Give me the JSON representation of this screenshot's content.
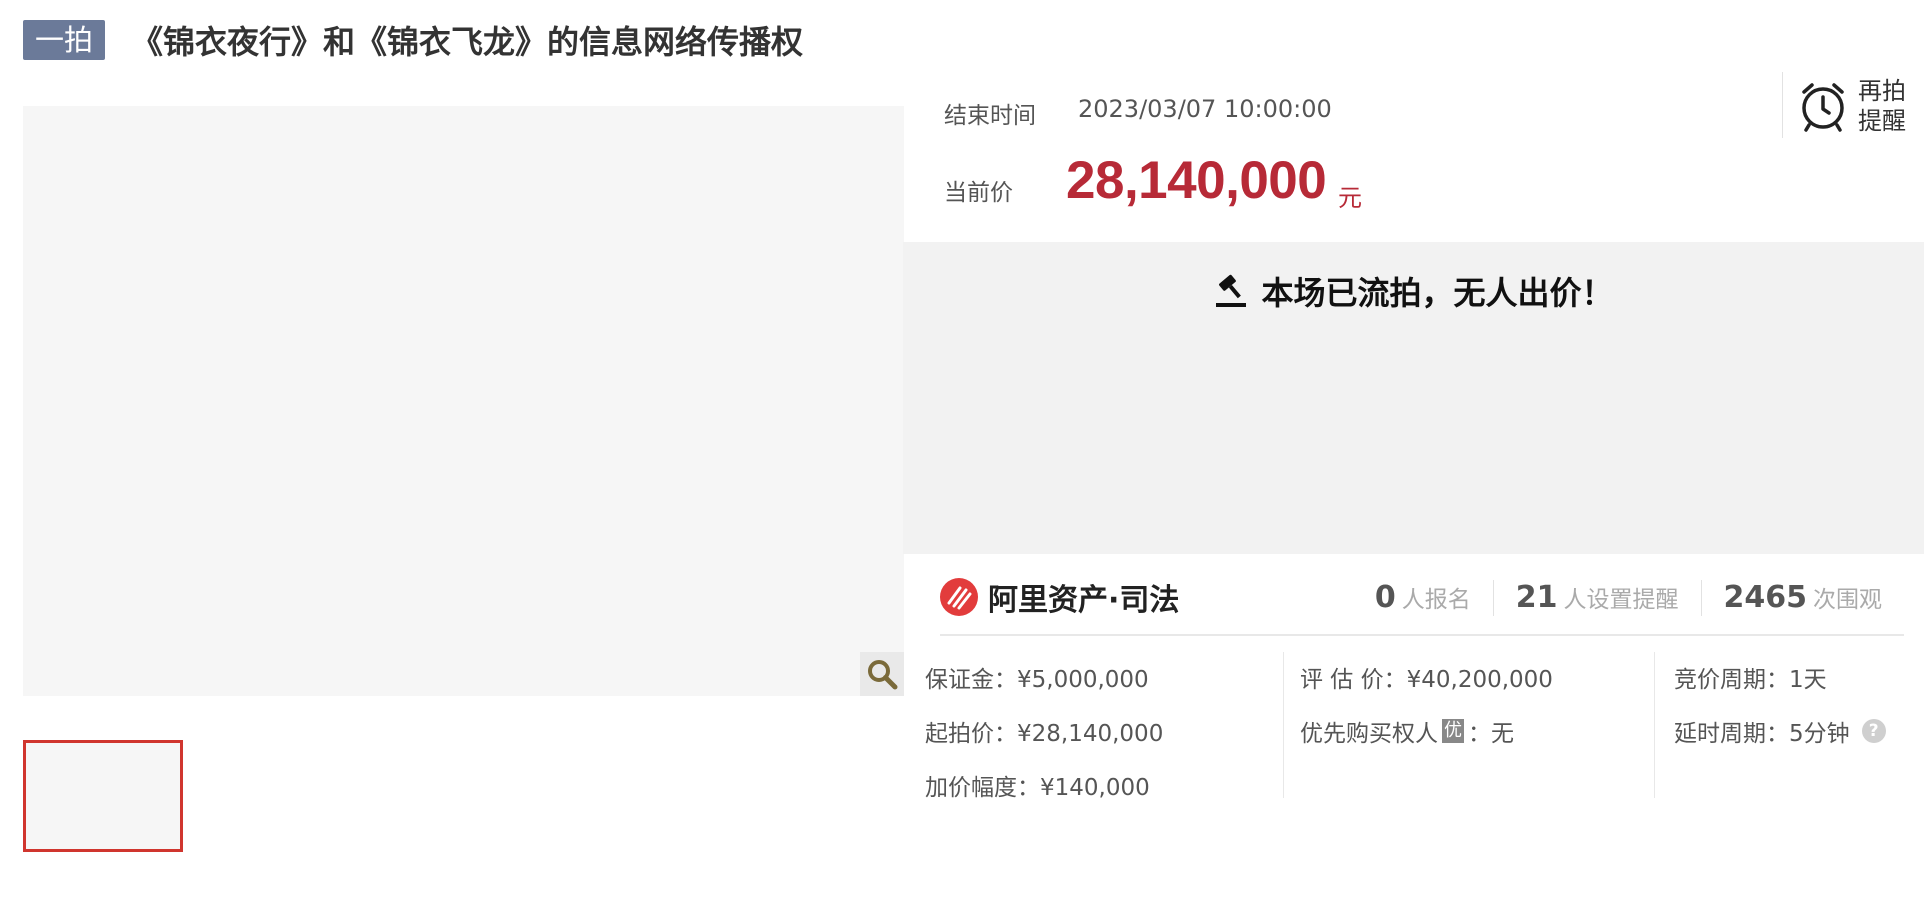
{
  "header": {
    "round_badge": "一拍",
    "title": "《锦衣夜行》和《锦衣飞龙》的信息网络传播权"
  },
  "gallery": {
    "zoom_icon": "magnifier-icon"
  },
  "auction": {
    "end_time_label": "结束时间",
    "end_time_value": "2023/03/07 10:00:00",
    "current_price_label": "当前价",
    "current_price": "28,140,000",
    "price_unit": "元",
    "remind_label": "再拍提醒",
    "remind_icon": "alarm-clock-icon",
    "status_text": "本场已流拍，无人出价！",
    "status_icon": "gavel-icon"
  },
  "brand": {
    "name": "阿里资产·司法",
    "logo_color": "#e23c3c"
  },
  "stats": [
    {
      "num": "0",
      "label": "人报名"
    },
    {
      "num": "21",
      "label": "人设置提醒"
    },
    {
      "num": "2465",
      "label": "次围观"
    }
  ],
  "details": {
    "deposit": "保证金：¥5,000,000",
    "start_price": "起拍价：¥28,140,000",
    "increment": "加价幅度：¥140,000",
    "appraisal": "评 估 价：¥40,200,000",
    "priority_label": "优先购买权人",
    "priority_tag": "优",
    "priority_value": "：无",
    "bid_cycle": "竞价周期：1天",
    "delay_cycle": "延时周期：5分钟",
    "help_glyph": "?"
  },
  "colors": {
    "price": "#b72a37",
    "badge": "#6b7a99",
    "thumb_border": "#d0352e"
  }
}
